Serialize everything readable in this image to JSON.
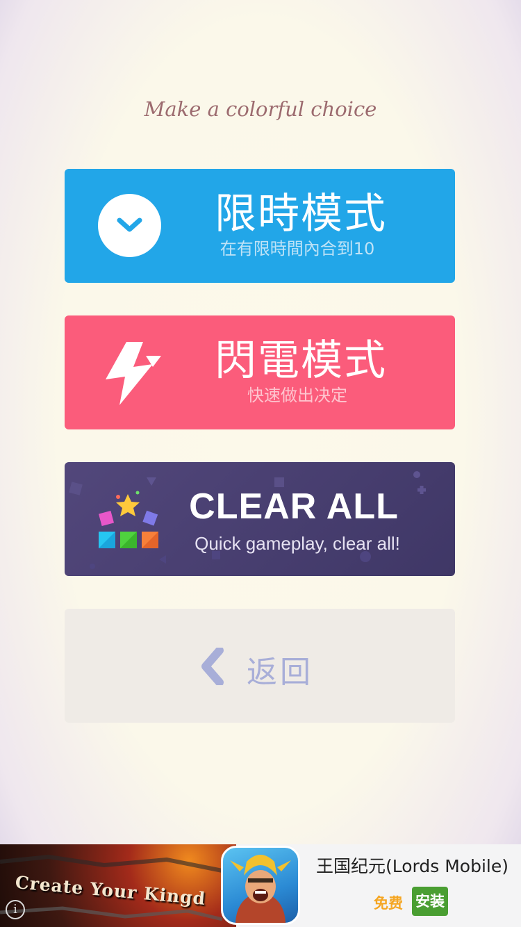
{
  "subtitle": "Make a colorful choice",
  "modes": {
    "timed": {
      "title": "限時模式",
      "subtitle": "在有限時間內合到10",
      "icon": "clock-icon",
      "color": "#22a6e8"
    },
    "flash": {
      "title": "閃電模式",
      "subtitle": "快速做出决定",
      "icon": "lightning-icon",
      "color": "#fb5c7b"
    },
    "clear_all": {
      "title": "CLEAR ALL",
      "subtitle": "Quick gameplay, clear all!",
      "icon": "colored-blocks-star-icon",
      "color": "#463d6e"
    }
  },
  "back": {
    "label": "返回",
    "icon": "chevron-left-icon",
    "color": "#a8aed8"
  },
  "ad": {
    "banner_text": "Create Your Kingd",
    "app_name": "王国纪元(Lords Mobile)",
    "price_label": "免费",
    "install_label": "安装",
    "info_icon": "info-icon"
  }
}
